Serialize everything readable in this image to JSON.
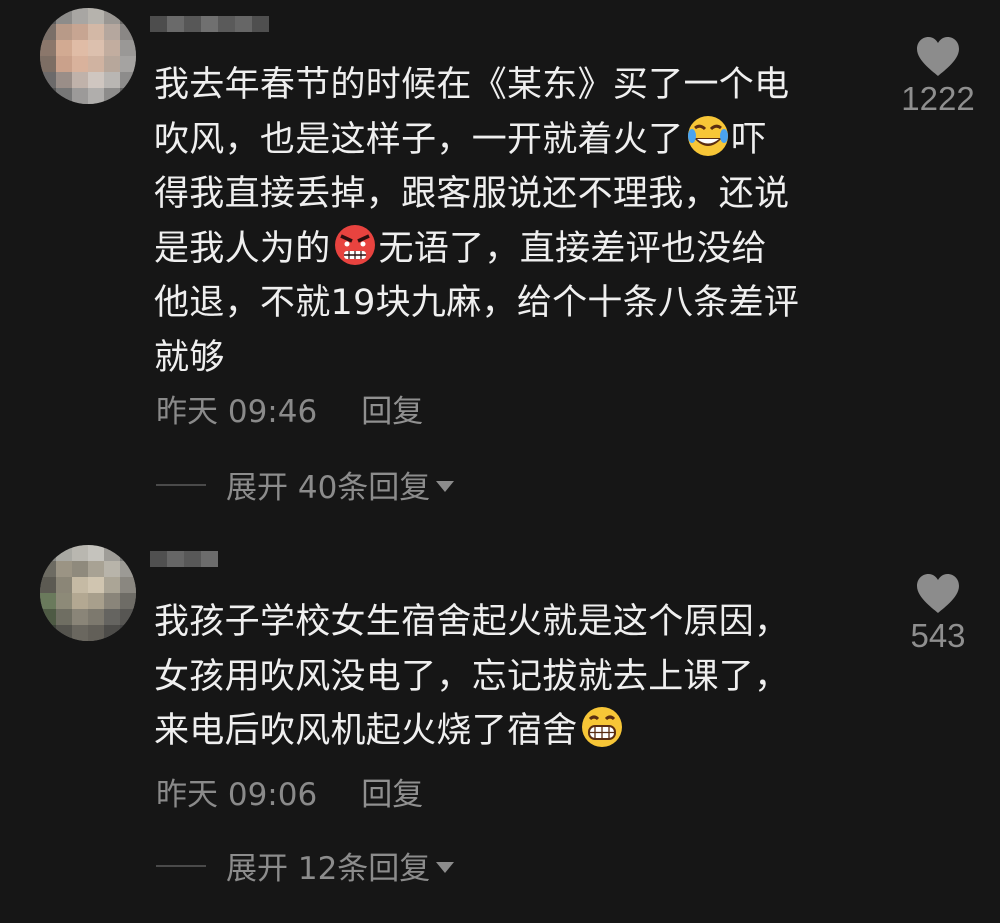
{
  "comments": [
    {
      "text_lines": [
        "我去年春节的时候在《某东》买了一个电",
        "吹风，也是这样子，一开就着火了",
        "吓",
        "得我直接丢掉，跟客服说还不理我，还说",
        "是我人为的",
        "无语了，直接差评也没给",
        "他退，不就19块九麻，给个十条八条差评",
        "就够"
      ],
      "time": "昨天 09:46",
      "reply_label": "回复",
      "expand_label": "展开 40条回复",
      "likes": "1222"
    },
    {
      "text_lines": [
        "我孩子学校女生宿舍起火就是这个原因，",
        "女孩用吹风没电了，忘记拔就去上课了，",
        "来电后吹风机起火烧了宿舍"
      ],
      "time": "昨天 09:06",
      "reply_label": "回复",
      "expand_label": "展开 12条回复",
      "likes": "543"
    }
  ],
  "icons": {
    "like": "heart-icon",
    "expand": "caret-down-icon",
    "emoji1": "rolling-laugh-emoji",
    "emoji2": "angry-emoji",
    "emoji3": "grin-emoji"
  }
}
